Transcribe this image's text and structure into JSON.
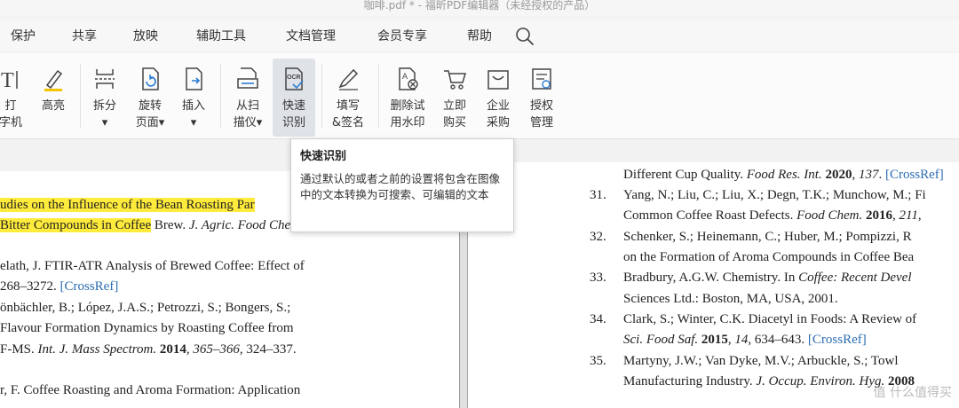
{
  "window": {
    "title": "咖啡.pdf * - 福昕PDF编辑器（未经授权的产品）"
  },
  "menu": [
    {
      "label": "保护"
    },
    {
      "label": "共享"
    },
    {
      "label": "放映"
    },
    {
      "label": "辅助工具"
    },
    {
      "label": "文档管理"
    },
    {
      "label": "会员专享"
    },
    {
      "label": "帮助"
    }
  ],
  "ribbon": {
    "tools": [
      {
        "label": "打\n字机"
      },
      {
        "label": "高亮"
      },
      {
        "label": "拆分\n▾"
      },
      {
        "label": "旋转\n页面▾"
      },
      {
        "label": "插入\n▾"
      },
      {
        "label": "从扫\n描仪▾"
      },
      {
        "label": "快速\n识别"
      },
      {
        "label": "填写\n&签名"
      },
      {
        "label": "删除试\n用水印"
      },
      {
        "label": "立即\n购买"
      },
      {
        "label": "企业\n采购"
      },
      {
        "label": "授权\n管理"
      }
    ]
  },
  "tooltip": {
    "title": "快速识别",
    "body": "通过默认的或者之前的设置将包含在图像中的文本转换为可搜索、可编辑的文本"
  },
  "left_page": {
    "lines": [
      {
        "segments": [
          {
            "text": "udies on the Influence of the Bean Roasting Par",
            "style": "hl"
          }
        ]
      },
      {
        "segments": [
          {
            "text": "Bitter Compounds in Coffee",
            "style": "hl"
          },
          {
            "text": " Brew. ",
            "style": ""
          },
          {
            "text": "J. Agric. Food Chem.",
            "style": "it"
          }
        ]
      },
      {
        "segments": [
          {
            "text": "elath, J. FTIR-ATR Analysis of Brewed Coffee: Effect of",
            "style": ""
          }
        ]
      },
      {
        "segments": [
          {
            "text": "268–3272. ",
            "style": ""
          },
          {
            "text": "[CrossRef]",
            "style": "link"
          }
        ]
      },
      {
        "segments": [
          {
            "text": "önbächler, B.; López, J.A.S.; Petrozzi, S.; Bongers, S.;",
            "style": ""
          }
        ]
      },
      {
        "segments": [
          {
            "text": "Flavour Formation Dynamics by Roasting Coffee from",
            "style": ""
          }
        ]
      },
      {
        "segments": [
          {
            "text": "F-MS. ",
            "style": ""
          },
          {
            "text": "Int. J. Mass Spectrom.",
            "style": "it"
          },
          {
            "text": " 2014",
            "style": "bd"
          },
          {
            "text": ", ",
            "style": ""
          },
          {
            "text": "365–366",
            "style": "it"
          },
          {
            "text": ", 324–337.",
            "style": ""
          }
        ]
      },
      {
        "segments": [
          {
            "text": "r, F. Coffee Roasting and Aroma Formation: Application",
            "style": ""
          }
        ]
      }
    ]
  },
  "right_page": {
    "lines": [
      {
        "num": "",
        "segments": [
          {
            "text": "Different Cup Quality. ",
            "style": ""
          },
          {
            "text": "Food Res. Int.",
            "style": "it"
          },
          {
            "text": " 2020",
            "style": "bd"
          },
          {
            "text": ", ",
            "style": ""
          },
          {
            "text": "137",
            "style": "it"
          },
          {
            "text": ". ",
            "style": ""
          },
          {
            "text": "[CrossRef]",
            "style": "link"
          }
        ]
      },
      {
        "num": "31.",
        "segments": [
          {
            "text": "Yang, N.; Liu, C.; Liu, X.; Degn, T.K.; Munchow, M.; Fi",
            "style": ""
          }
        ]
      },
      {
        "num": "",
        "segments": [
          {
            "text": "Common Coffee Roast Defects. ",
            "style": ""
          },
          {
            "text": "Food Chem.",
            "style": "it"
          },
          {
            "text": " 2016",
            "style": "bd"
          },
          {
            "text": ", ",
            "style": ""
          },
          {
            "text": "211",
            "style": "it"
          },
          {
            "text": ",",
            "style": ""
          }
        ]
      },
      {
        "num": "32.",
        "segments": [
          {
            "text": "Schenker, S.; Heinemann, C.; Huber, M.; Pompizzi, R",
            "style": ""
          }
        ]
      },
      {
        "num": "",
        "segments": [
          {
            "text": "on the Formation of Aroma Compounds in Coffee Bea",
            "style": ""
          }
        ]
      },
      {
        "num": "33.",
        "segments": [
          {
            "text": "Bradbury, A.G.W. Chemistry. In ",
            "style": ""
          },
          {
            "text": "Coffee: Recent Devel",
            "style": "it"
          }
        ]
      },
      {
        "num": "",
        "segments": [
          {
            "text": "Sciences Ltd.: Boston, MA, USA, 2001.",
            "style": ""
          }
        ]
      },
      {
        "num": "34.",
        "segments": [
          {
            "text": "Clark, S.; Winter, C.K. Diacetyl in Foods: A Review of",
            "style": ""
          }
        ]
      },
      {
        "num": "",
        "segments": [
          {
            "text": "Sci. Food Saf.",
            "style": "it"
          },
          {
            "text": " 2015",
            "style": "bd"
          },
          {
            "text": ", ",
            "style": ""
          },
          {
            "text": "14",
            "style": "it"
          },
          {
            "text": ", 634–643. ",
            "style": ""
          },
          {
            "text": "[CrossRef]",
            "style": "link"
          }
        ]
      },
      {
        "num": "35.",
        "segments": [
          {
            "text": "Martyny, J.W.; Van Dyke, M.V.; Arbuckle, S.; Towl",
            "style": ""
          }
        ]
      },
      {
        "num": "",
        "segments": [
          {
            "text": "Manufacturing Industry. ",
            "style": ""
          },
          {
            "text": "J. Occup. Environ. Hyg.",
            "style": "it"
          },
          {
            "text": " 2008",
            "style": "bd"
          }
        ]
      }
    ]
  },
  "watermark": "值 什么值得买",
  "colors": {
    "highlight": "#ffeb3b",
    "link": "#2b6cb0",
    "active_tool": "#dfe3e8"
  }
}
